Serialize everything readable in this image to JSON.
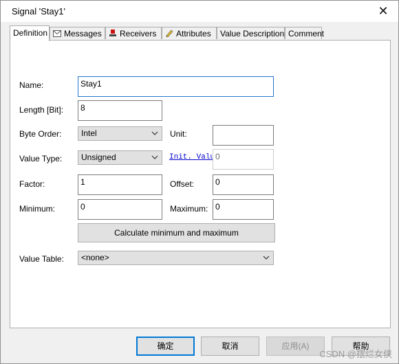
{
  "window": {
    "title": "Signal 'Stay1'"
  },
  "tabs": [
    {
      "label": "Definition",
      "icon": "none",
      "active": true
    },
    {
      "label": "Messages",
      "icon": "envelope-icon"
    },
    {
      "label": "Receivers",
      "icon": "receiver-icon"
    },
    {
      "label": "Attributes",
      "icon": "pencil-icon"
    },
    {
      "label": "Value Descriptions",
      "icon": "none"
    },
    {
      "label": "Comment",
      "icon": "none"
    }
  ],
  "form": {
    "name": {
      "label": "Name:",
      "value": "Stay1"
    },
    "length": {
      "label": "Length [Bit]:",
      "value": "8"
    },
    "byte_order": {
      "label": "Byte Order:",
      "value": "Intel"
    },
    "unit": {
      "label": "Unit:",
      "value": ""
    },
    "value_type": {
      "label": "Value Type:",
      "value": "Unsigned"
    },
    "init_value": {
      "label": "Init. Value",
      "value": "0"
    },
    "factor": {
      "label": "Factor:",
      "value": "1"
    },
    "offset": {
      "label": "Offset:",
      "value": "0"
    },
    "minimum": {
      "label": "Minimum:",
      "value": "0"
    },
    "maximum": {
      "label": "Maximum:",
      "value": "0"
    },
    "calculate_button": "Calculate minimum and maximum",
    "value_table": {
      "label": "Value Table:",
      "value": "<none>"
    }
  },
  "footer": {
    "ok": "确定",
    "cancel": "取消",
    "apply": "应用(A)",
    "help": "帮助"
  },
  "watermark": "CSDN @摆烂女侠",
  "colors": {
    "accent": "#0078d7",
    "link": "#0000cc",
    "focus_border": "#2277cc"
  }
}
